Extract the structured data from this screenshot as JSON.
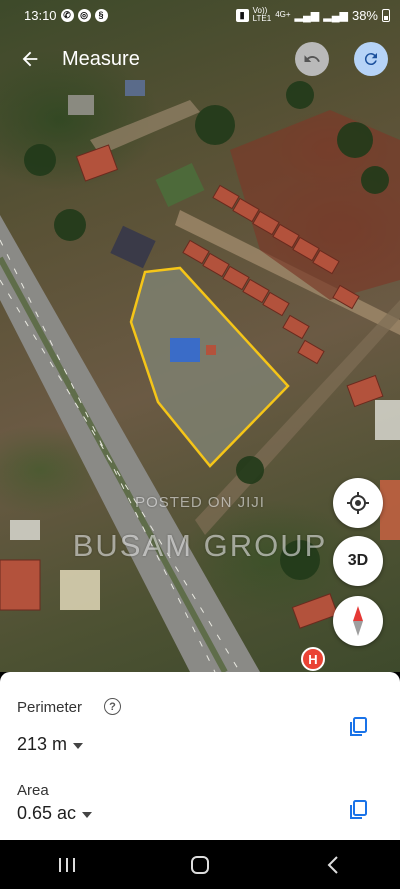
{
  "status_bar": {
    "time": "13:10",
    "network": "Vo))",
    "network_sub": "LTE1",
    "network_type": "4G+",
    "battery": "38%",
    "icons": [
      "phone-icon",
      "instagram-icon",
      "data-saver-icon",
      "sim-lock-icon",
      "signal-icon",
      "battery-icon"
    ]
  },
  "app_bar": {
    "title": "Measure",
    "icons": [
      "back-arrow-icon",
      "undo-icon",
      "redo-icon"
    ]
  },
  "map": {
    "watermark_line1": "POSTED ON JIJI",
    "watermark_line2": "BUSAM GROUP",
    "polygon_color": "#f5c518",
    "hospital_marker": "H"
  },
  "controls": {
    "three_d_label": "3D",
    "icons": [
      "my-location-icon",
      "compass-icon"
    ]
  },
  "measurements": {
    "perimeter_label": "Perimeter",
    "perimeter_value": "213 m",
    "area_label": "Area",
    "area_value": "0.65 ac",
    "help_glyph": "?"
  },
  "colors": {
    "accent": "#1a73e8",
    "redo_bg": "#b6d3f7",
    "undo_bg": "#b9b9b9"
  }
}
